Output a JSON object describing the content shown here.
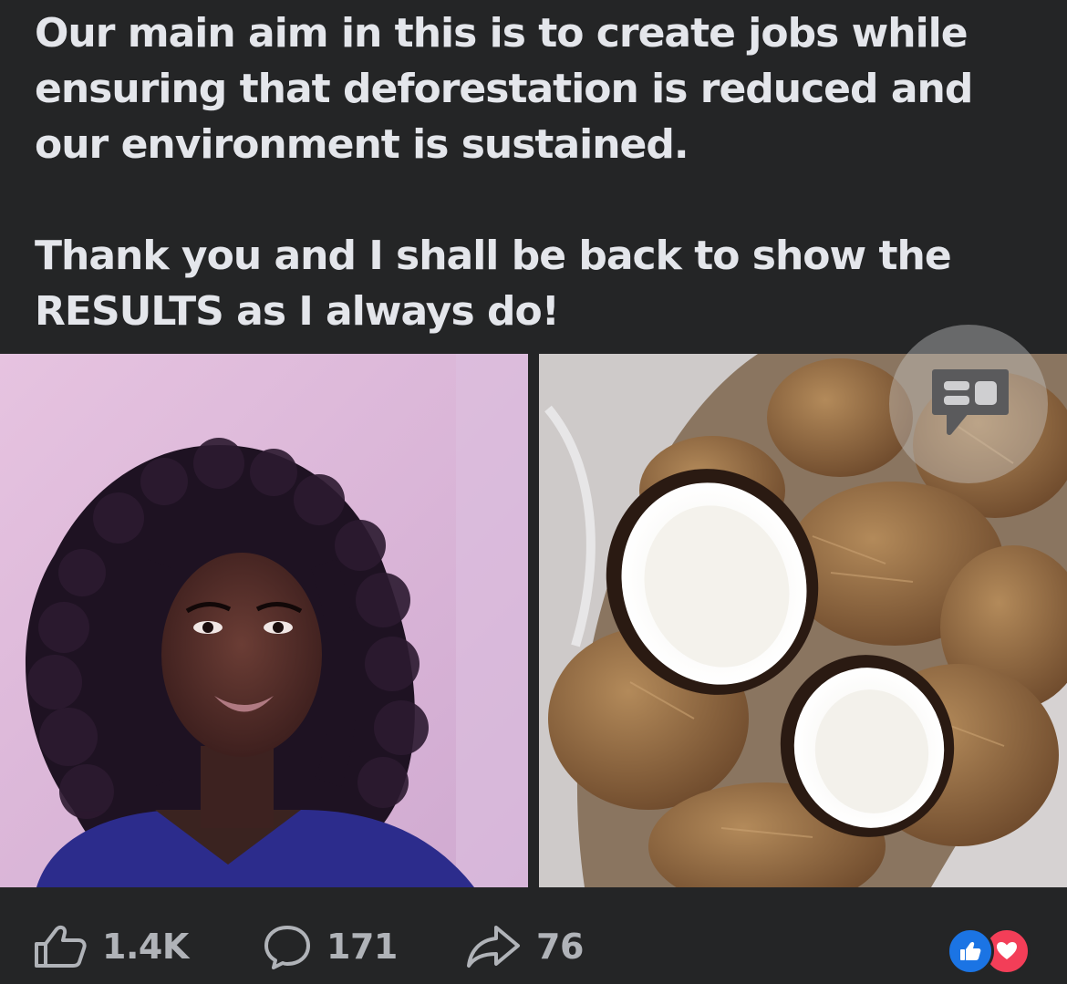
{
  "post": {
    "paragraph_1": "Our main aim in this is to create jobs while\nensuring that deforestation is reduced and\nour environment is sustained.",
    "paragraph_2": "Thank you and I shall be back to show the\nRESULTS as I always do!"
  },
  "media": {
    "photos": [
      {
        "subject": "portrait"
      },
      {
        "subject": "coconuts"
      }
    ],
    "overlay_icon": "chat-bubble-icon"
  },
  "actions": {
    "like_count": "1.4K",
    "comment_count": "171",
    "share_count": "76",
    "icons": [
      "thumbs-up-icon",
      "comment-icon",
      "share-icon"
    ]
  },
  "reactions": [
    "like",
    "love"
  ],
  "colors": {
    "background": "#242526",
    "text": "#e4e6eb",
    "muted": "#b0b3b8",
    "like_blue": "#1b74e4",
    "love_red": "#f33e58"
  }
}
